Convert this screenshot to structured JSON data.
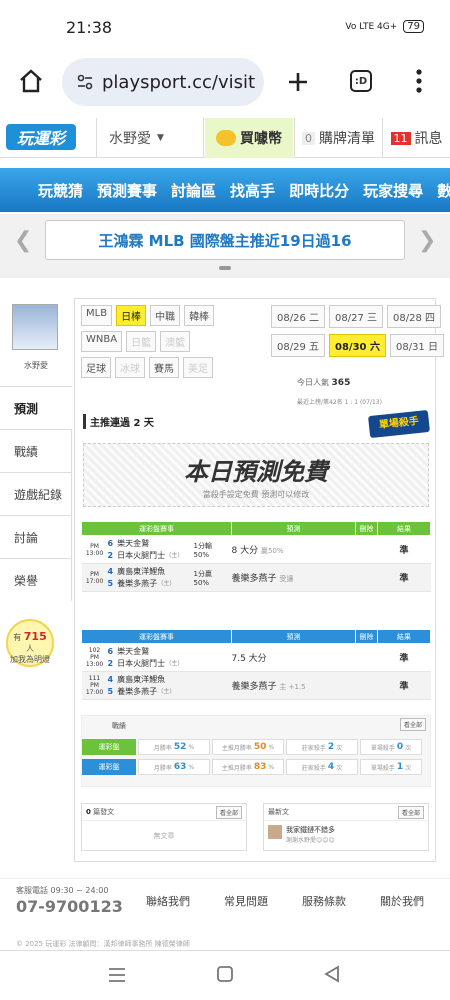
{
  "status": {
    "time": "21:38",
    "signal": "Vo LTE 4G+",
    "battery": "79"
  },
  "browser": {
    "url": "playsport.cc/visit",
    "tabs": ":D"
  },
  "site": {
    "logo": "玩運彩",
    "user": "水野愛",
    "buy": "買噱幣",
    "cart_count": "0",
    "cart_label": "購牌清單",
    "msg_count": "11",
    "msg_label": "訊息"
  },
  "nav": [
    "玩競猜",
    "預測賽事",
    "討論區",
    "找高手",
    "即時比分",
    "玩家搜尋",
    "數據"
  ],
  "marquee": {
    "text": "王鴻霖 MLB 國際盤主推近19日過16"
  },
  "sidebar": {
    "username": "水野愛",
    "menu": [
      "預測",
      "戰績",
      "遊戲紀錄",
      "討論",
      "榮譽"
    ],
    "bulb_prefix": "有",
    "bulb_count": "715",
    "bulb_unit": "人",
    "bulb_suffix": "加我為明燈"
  },
  "leagues": {
    "row1": [
      "MLB",
      "日棒",
      "中職",
      "韓棒"
    ],
    "row2": [
      "WNBA",
      "日籃",
      "澳籃"
    ],
    "row3": [
      "足球",
      "冰球",
      "賽馬",
      "美足"
    ]
  },
  "dates": {
    "row1": [
      "08/26 二",
      "08/27 三",
      "08/28 四"
    ],
    "row2": [
      "08/29 五",
      "08/30 六",
      "08/31 日"
    ]
  },
  "stats": {
    "pop_label": "今日人氣",
    "pop_value": "365",
    "rank": "最近上榜/第42名 1 : 1 (07/13)",
    "expert_badge": "單場殺手",
    "streak": "主推連過 2 天"
  },
  "free": {
    "title": "本日預測免費",
    "sub": "當殺手設定免費 預測可以修改"
  },
  "table1": {
    "headers": [
      "運彩盤賽事",
      "預測",
      "刪除",
      "結果"
    ],
    "rows": [
      {
        "time": "PM 13:00",
        "n1": "6",
        "t1": "樂天金鷲",
        "n2": "2",
        "t2": "日本火腿鬥士",
        "mark2": "(主)",
        "odds": "1分輸",
        "pct": "50%",
        "pick": "8 大分",
        "sub": "贏50%",
        "result": "準"
      },
      {
        "time": "PM 17:00",
        "n1": "4",
        "t1": "廣島東洋鯉魚",
        "n2": "5",
        "t2": "養樂多燕子",
        "mark2": "(主)",
        "odds": "1分贏",
        "pct": "50%",
        "pick": "養樂多燕子",
        "sub": "受讓",
        "result": "準"
      }
    ]
  },
  "table2": {
    "headers": [
      "運彩盤賽事",
      "預測",
      "刪除",
      "結果"
    ],
    "rows": [
      {
        "time": "102",
        "time2": "PM 13:00",
        "n1": "6",
        "t1": "樂天金鷲",
        "n2": "2",
        "t2": "日本火腿鬥士",
        "mark2": "(主)",
        "pick": "7.5 大分",
        "sub": "",
        "result": "準"
      },
      {
        "time": "111",
        "time2": "PM 17:00",
        "n1": "4",
        "t1": "廣島東洋鯉魚",
        "n2": "5",
        "t2": "養樂多燕子",
        "mark2": "(主)",
        "pick": "養樂多燕子",
        "sub": "主 +1.5",
        "result": "準"
      }
    ]
  },
  "record": {
    "title": "戰績",
    "all": "看全部",
    "rows": [
      {
        "tag": "運彩盤",
        "color": "#6bc33b",
        "win_label": "月勝率",
        "win": "52",
        "main_label": "主推月勝率",
        "main": "50",
        "streak_label": "莊家殺手",
        "streak": "2",
        "streak_unit": "次",
        "single_label": "單場殺手",
        "single": "0",
        "single_unit": "次"
      },
      {
        "tag": "運彩盤",
        "color": "#2c8fd8",
        "win_label": "月勝率",
        "win": "63",
        "main_label": "主推月勝率",
        "main": "83",
        "streak_label": "莊家殺手",
        "streak": "4",
        "streak_unit": "次",
        "single_label": "單場殺手",
        "single": "1",
        "single_unit": "次"
      }
    ]
  },
  "articles": {
    "count": "0",
    "label": "篇發文",
    "all": "看全部",
    "empty": "無文章"
  },
  "latest": {
    "label": "最新文",
    "all": "看全部",
    "post_title": "我家鐵鏈不錯多",
    "post_meta": "謝謝水野愛😊😊😊"
  },
  "footer": {
    "hotline_label": "客服電話 09:30 ~ 24:00",
    "phone": "07-9700123",
    "links": [
      "聯絡我們",
      "常見問題",
      "服務條款",
      "關於我們"
    ],
    "copyright": "© 2025 玩運彩 法律顧問：漢邦律師事務所 陳德榮律師"
  }
}
